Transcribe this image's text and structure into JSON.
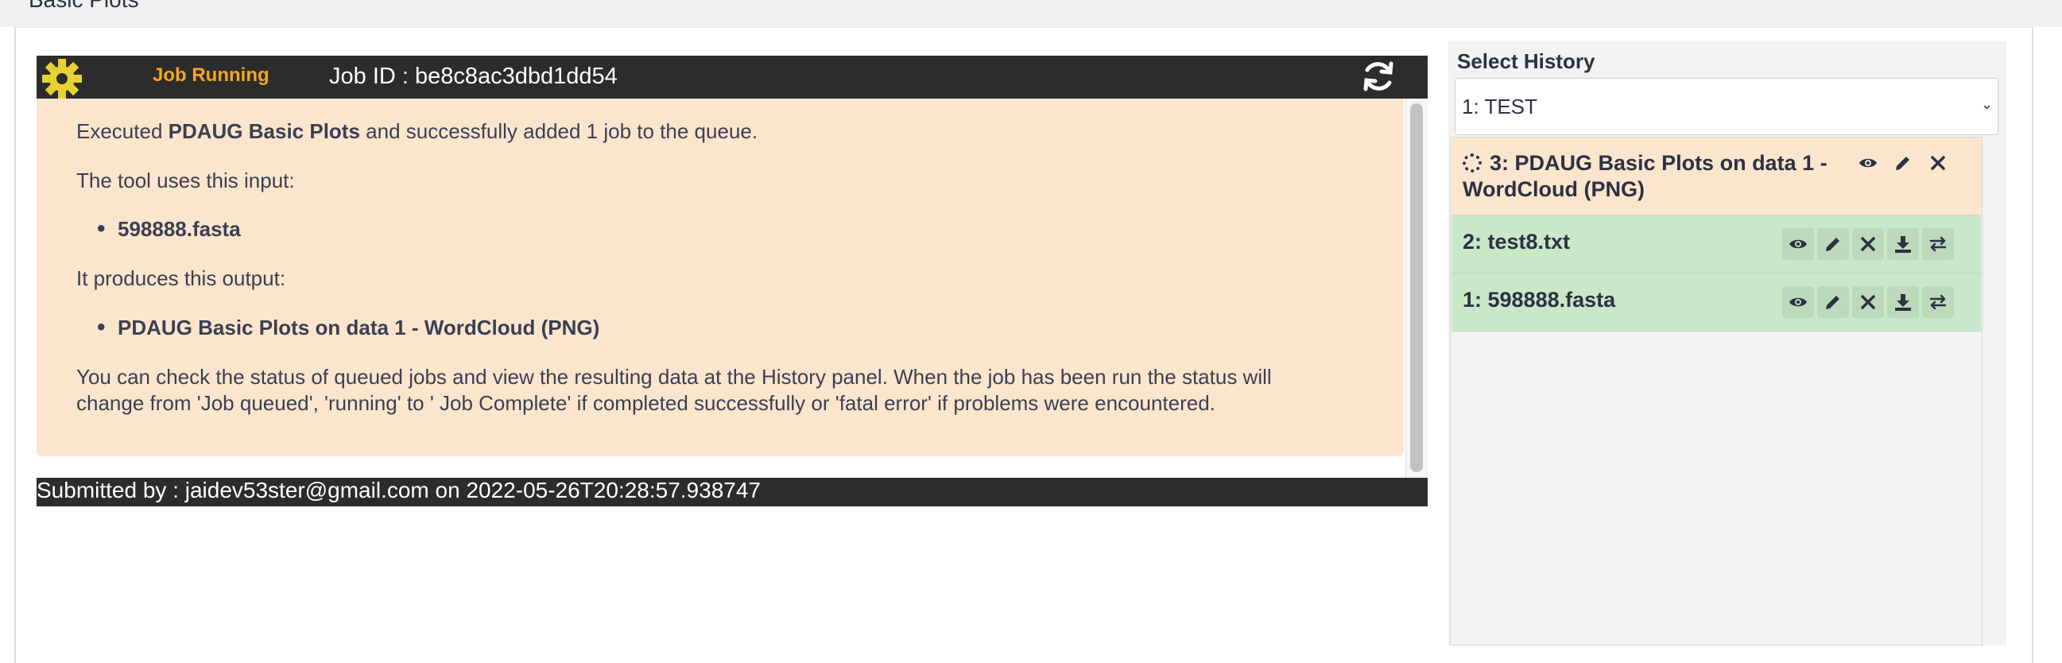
{
  "page": {
    "title": "Basic Plots"
  },
  "job": {
    "status": "Job Running",
    "id_text": "Job ID : be8c8ac3dbd1dd54",
    "executed_prefix": "Executed ",
    "tool_name": "PDAUG Basic Plots",
    "executed_suffix": " and successfully added 1 job to the queue.",
    "input_label": "The tool uses this input:",
    "input_file": "598888.fasta",
    "output_label": "It produces this output:",
    "output_file": "PDAUG Basic Plots on data 1 - WordCloud (PNG)",
    "status_line1": "You can check the status of queued jobs and view the resulting data at the History panel. When the job has been run the status will",
    "status_line2": "change from 'Job queued', 'running' to ' Job Complete' if completed successfully or 'fatal error' if problems were encountered.",
    "footer": "Submitted by : jaidev53ster@gmail.com on 2022-05-26T20:28:57.938747"
  },
  "history": {
    "label": "Select History",
    "selected": "1: TEST",
    "items": [
      {
        "title_line1": "3: PDAUG Basic Plots on data 1 -",
        "title_line2": "WordCloud (PNG)",
        "state": "running"
      },
      {
        "title": "2: test8.txt",
        "state": "ok"
      },
      {
        "title": "1: 598888.fasta",
        "state": "ok"
      }
    ]
  },
  "colors": {
    "header_bg": "#2c2c2c",
    "running_bg": "#fbe5cd",
    "ok_bg": "#c9e8c8",
    "status_orange": "#f5a623"
  }
}
